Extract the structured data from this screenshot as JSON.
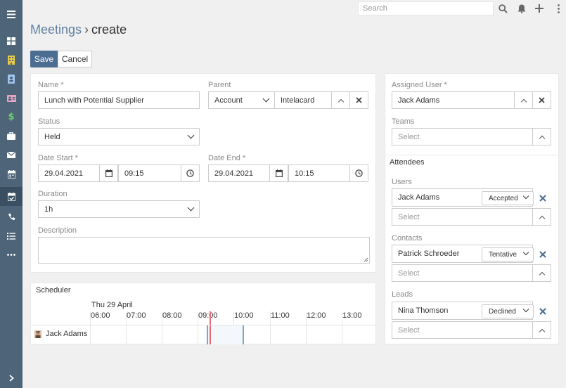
{
  "topbar": {
    "search_placeholder": "Search",
    "icons": [
      "search-icon",
      "bell-icon",
      "plus-icon",
      "more-vertical-icon"
    ]
  },
  "sidebar": {
    "items": [
      {
        "icon": "dashboard-icon"
      },
      {
        "icon": "building-icon"
      },
      {
        "icon": "contact-book-icon"
      },
      {
        "icon": "id-card-icon"
      },
      {
        "icon": "dollar-icon"
      },
      {
        "icon": "briefcase-icon"
      },
      {
        "icon": "envelope-icon"
      },
      {
        "icon": "calendar-icon"
      },
      {
        "icon": "calendar-check-icon",
        "active": true
      },
      {
        "icon": "phone-icon"
      },
      {
        "icon": "tasks-icon"
      },
      {
        "icon": "more-icon"
      }
    ],
    "colors": {
      "bg": "#4e6478",
      "active": "#3a4f62"
    }
  },
  "page": {
    "breadcrumb_parent": "Meetings",
    "separator": "›",
    "action": "create"
  },
  "buttons": {
    "save": "Save",
    "cancel": "Cancel"
  },
  "form": {
    "name_label": "Name *",
    "name_value": "Lunch with Potential Supplier",
    "parent_label": "Parent",
    "parent_type": "Account",
    "parent_value": "Intelacard",
    "status_label": "Status",
    "status_value": "Held",
    "date_start_label": "Date Start *",
    "date_start_date": "29.04.2021",
    "date_start_time": "09:15",
    "date_end_label": "Date End *",
    "date_end_date": "29.04.2021",
    "date_end_time": "10:15",
    "duration_label": "Duration",
    "duration_value": "1h",
    "description_label": "Description",
    "description_value": ""
  },
  "scheduler": {
    "title": "Scheduler",
    "date": "Thu 29 April",
    "hours": [
      "06:00",
      "07:00",
      "08:00",
      "09:00",
      "10:00",
      "11:00",
      "12:00",
      "13:00"
    ],
    "user": "Jack Adams"
  },
  "side": {
    "assigned_user_label": "Assigned User *",
    "assigned_user_value": "Jack Adams",
    "teams_label": "Teams",
    "teams_placeholder": "Select",
    "attendees_title": "Attendees",
    "users_label": "Users",
    "users": [
      {
        "name": "Jack Adams",
        "status": "Accepted"
      }
    ],
    "users_placeholder": "Select",
    "contacts_label": "Contacts",
    "contacts": [
      {
        "name": "Patrick Schroeder",
        "status": "Tentative"
      }
    ],
    "contacts_placeholder": "Select",
    "leads_label": "Leads",
    "leads": [
      {
        "name": "Nina Thomson",
        "status": "Declined"
      }
    ],
    "leads_placeholder": "Select"
  },
  "colors": {
    "accent": "#4b6d92",
    "link": "#5f80a4",
    "sidebar": "#4e6478",
    "now_line": "#e06c75",
    "event_marker": "#7fa6c9",
    "remove_x": "#4a6c8f"
  }
}
